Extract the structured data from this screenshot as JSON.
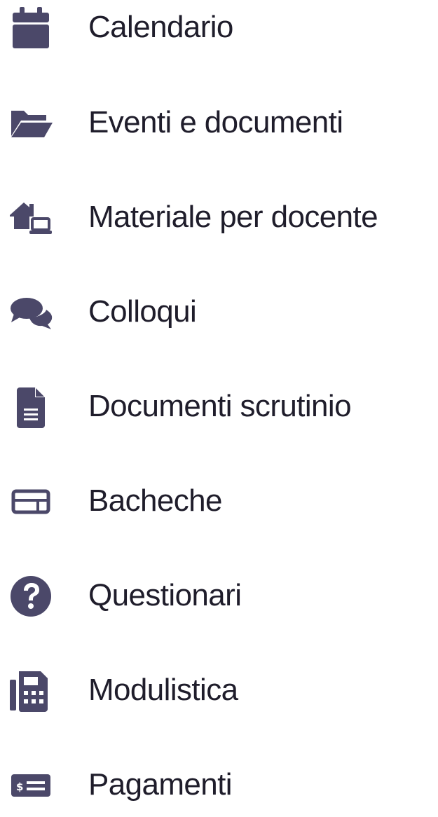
{
  "colors": {
    "icon": "#4b4869",
    "text": "#1f1d2b",
    "background": "#ffffff"
  },
  "menu": {
    "items": [
      {
        "label": "Calendario",
        "icon": "calendar-icon"
      },
      {
        "label": "Eventi e documenti",
        "icon": "folder-open-icon"
      },
      {
        "label": "Materiale per docente",
        "icon": "house-laptop-icon"
      },
      {
        "label": "Colloqui",
        "icon": "comments-icon"
      },
      {
        "label": "Documenti scrutinio",
        "icon": "file-lines-icon"
      },
      {
        "label": "Bacheche",
        "icon": "board-icon"
      },
      {
        "label": "Questionari",
        "icon": "question-circle-icon"
      },
      {
        "label": "Modulistica",
        "icon": "fax-icon"
      },
      {
        "label": "Pagamenti",
        "icon": "money-check-icon"
      }
    ]
  }
}
